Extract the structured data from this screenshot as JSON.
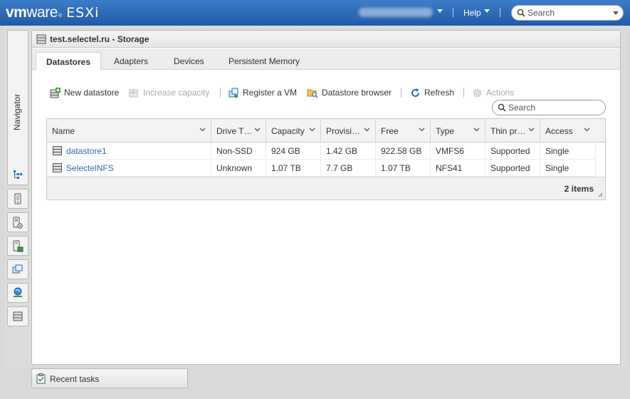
{
  "header": {
    "brand_vm": "vm",
    "brand_ware": "ware",
    "brand_product": "ESXi",
    "help_label": "Help",
    "search_placeholder": "Search"
  },
  "navigator": {
    "label": "Navigator"
  },
  "panel": {
    "title": "test.selectel.ru - Storage",
    "tabs": [
      {
        "label": "Datastores",
        "active": true
      },
      {
        "label": "Adapters",
        "active": false
      },
      {
        "label": "Devices",
        "active": false
      },
      {
        "label": "Persistent Memory",
        "active": false
      }
    ]
  },
  "toolbar": {
    "new_datastore": "New datastore",
    "increase_capacity": "Increase capacity",
    "register_vm": "Register a VM",
    "datastore_browser": "Datastore browser",
    "refresh": "Refresh",
    "actions": "Actions"
  },
  "grid": {
    "search_placeholder": "Search",
    "columns": [
      "Name",
      "Drive T…",
      "Capacity",
      "Provisi…",
      "Free",
      "Type",
      "Thin pr…",
      "Access"
    ],
    "rows": [
      {
        "name": "datastore1",
        "drive_type": "Non-SSD",
        "capacity": "924 GB",
        "provisioned": "1.42 GB",
        "free": "922.58 GB",
        "type": "VMFS6",
        "thin": "Supported",
        "access": "Single"
      },
      {
        "name": "SelectelNFS",
        "drive_type": "Unknown",
        "capacity": "1.07 TB",
        "provisioned": "7.7 GB",
        "free": "1.07 TB",
        "type": "NFS41",
        "thin": "Supported",
        "access": "Single"
      }
    ],
    "item_count": "2 items"
  },
  "recent_tasks": {
    "label": "Recent tasks"
  },
  "colors": {
    "topbar": "#2a67b5",
    "link": "#2a6cb7"
  }
}
